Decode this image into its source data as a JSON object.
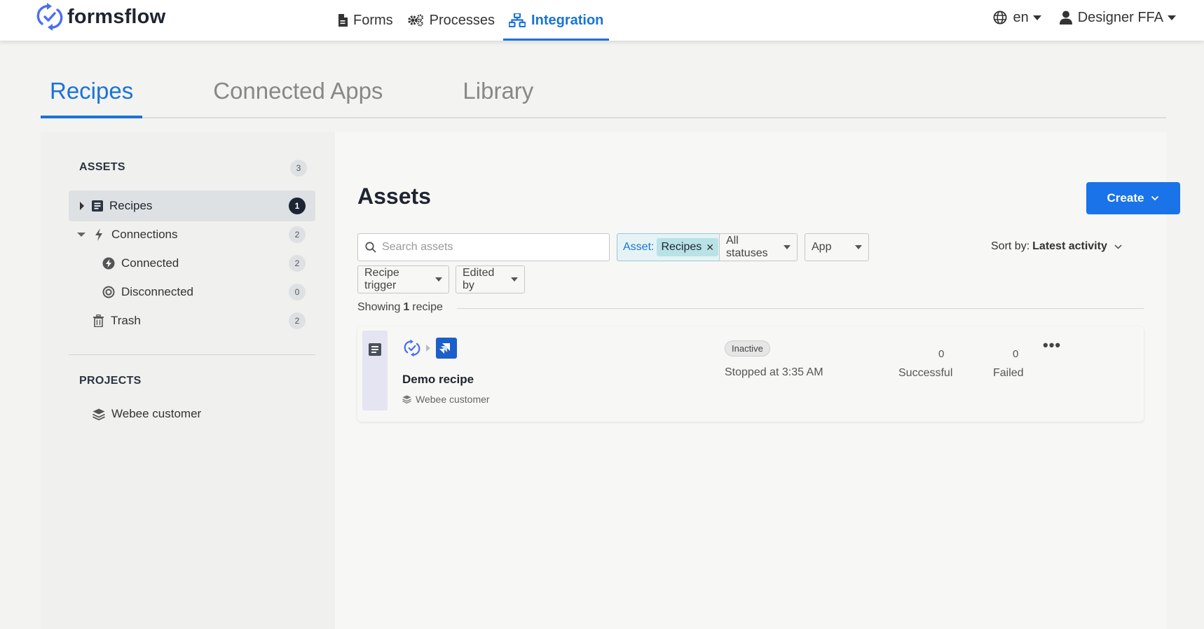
{
  "app": {
    "brand": "formsflow"
  },
  "nav": {
    "items": [
      {
        "label": "Forms",
        "icon": "file-icon"
      },
      {
        "label": "Processes",
        "icon": "gears-icon"
      },
      {
        "label": "Integration",
        "icon": "sitemap-icon",
        "active": true
      }
    ],
    "language": "en",
    "user": "Designer FFA"
  },
  "tabs": [
    {
      "label": "Recipes",
      "active": true
    },
    {
      "label": "Connected Apps"
    },
    {
      "label": "Library"
    }
  ],
  "sidebar": {
    "assets_heading": "ASSETS",
    "assets_count": "3",
    "items": [
      {
        "label": "Recipes",
        "count": "1",
        "active": true
      },
      {
        "label": "Connections",
        "count": "2"
      },
      {
        "label": "Connected",
        "count": "2"
      },
      {
        "label": "Disconnected",
        "count": "0"
      },
      {
        "label": "Trash",
        "count": "2"
      }
    ],
    "projects_heading": "PROJECTS",
    "projects": [
      {
        "label": "Webee customer"
      }
    ]
  },
  "main": {
    "title": "Assets",
    "create_label": "Create",
    "search_placeholder": "Search assets",
    "filters": {
      "asset_prefix": "Asset:",
      "asset_value": "Recipes",
      "status": "All statuses",
      "app": "App",
      "trigger": "Recipe trigger",
      "edited_by": "Edited by"
    },
    "sort_prefix": "Sort by:",
    "sort_value": "Latest activity",
    "showing_prefix": "Showing",
    "showing_count": "1",
    "showing_suffix": "recipe"
  },
  "recipe": {
    "name": "Demo recipe",
    "project": "Webee customer",
    "status": "Inactive",
    "stopped": "Stopped at 3:35 AM",
    "successful_count": "0",
    "successful_label": "Successful",
    "failed_count": "0",
    "failed_label": "Failed",
    "more": "•••"
  },
  "colors": {
    "accent": "#1a73d8",
    "create_button": "#1a73e8",
    "active_badge": "#1b2533",
    "chip_bg": "#e5f3f5"
  }
}
